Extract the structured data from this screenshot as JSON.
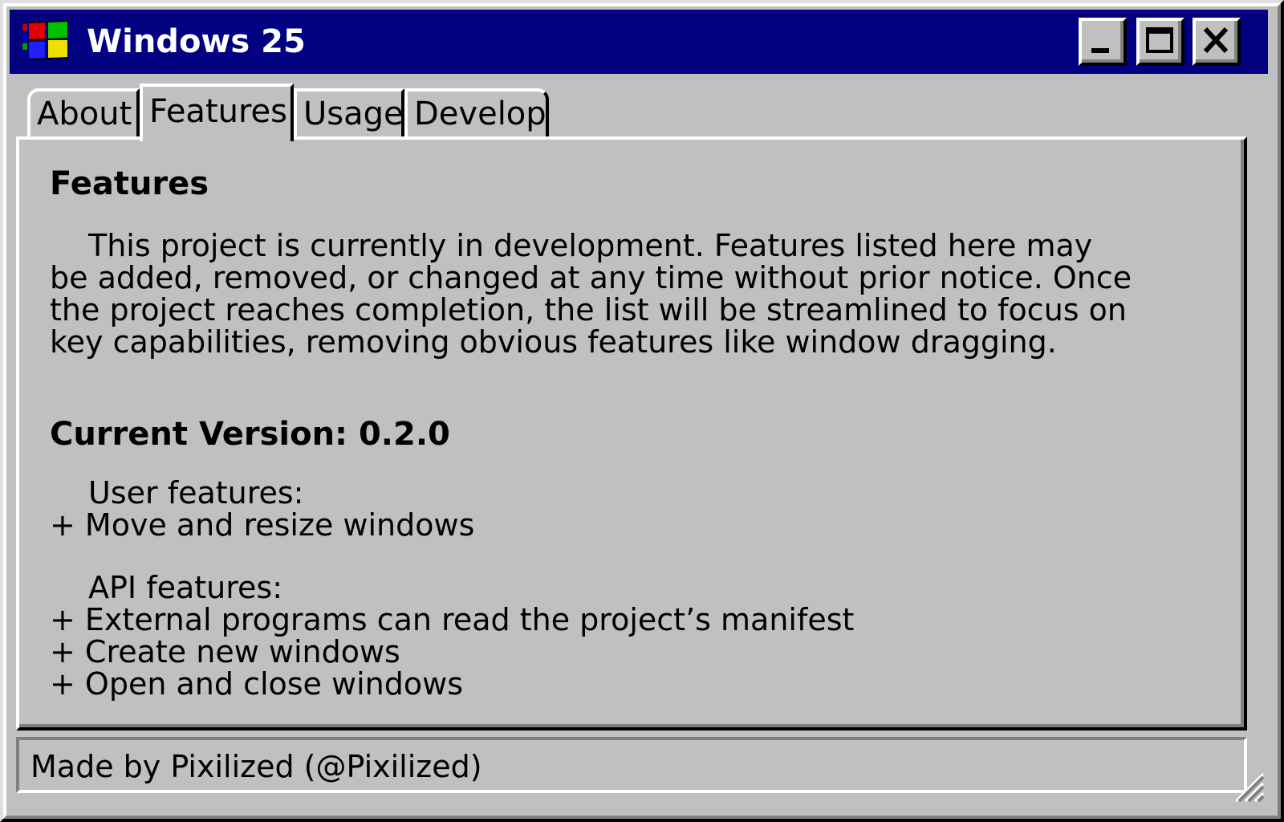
{
  "window": {
    "title": "Windows 25",
    "icon": "windows-logo-icon",
    "controls": {
      "minimize": "minimize-icon",
      "maximize": "maximize-icon",
      "close": "close-icon"
    }
  },
  "tabs": [
    {
      "label": "About",
      "active": false
    },
    {
      "label": "Features",
      "active": true
    },
    {
      "label": "Usage",
      "active": false
    },
    {
      "label": "Develop",
      "active": false
    }
  ],
  "content": {
    "heading": "Features",
    "paragraph": "This project is currently in development. Features listed here may be added, removed, or changed at any time without prior notice. Once the project reaches completion, the list will be streamlined to focus on key capabilities, removing obvious features like window dragging.",
    "version_heading": "Current Version: 0.2.0",
    "user_features": {
      "label": "User features:",
      "items": [
        "+ Move and resize windows"
      ]
    },
    "api_features": {
      "label": "API features:",
      "items": [
        "+ External programs can read the project’s manifest",
        "+ Create new windows",
        "+ Open and close windows"
      ]
    }
  },
  "statusbar": {
    "text": "Made by Pixilized (@Pixilized)",
    "grip": "resize-grip-icon"
  },
  "colors": {
    "titlebar": "#000080",
    "face": "#c0c0c0",
    "highlight": "#ffffff",
    "shadow": "#808080",
    "dark": "#000000"
  }
}
